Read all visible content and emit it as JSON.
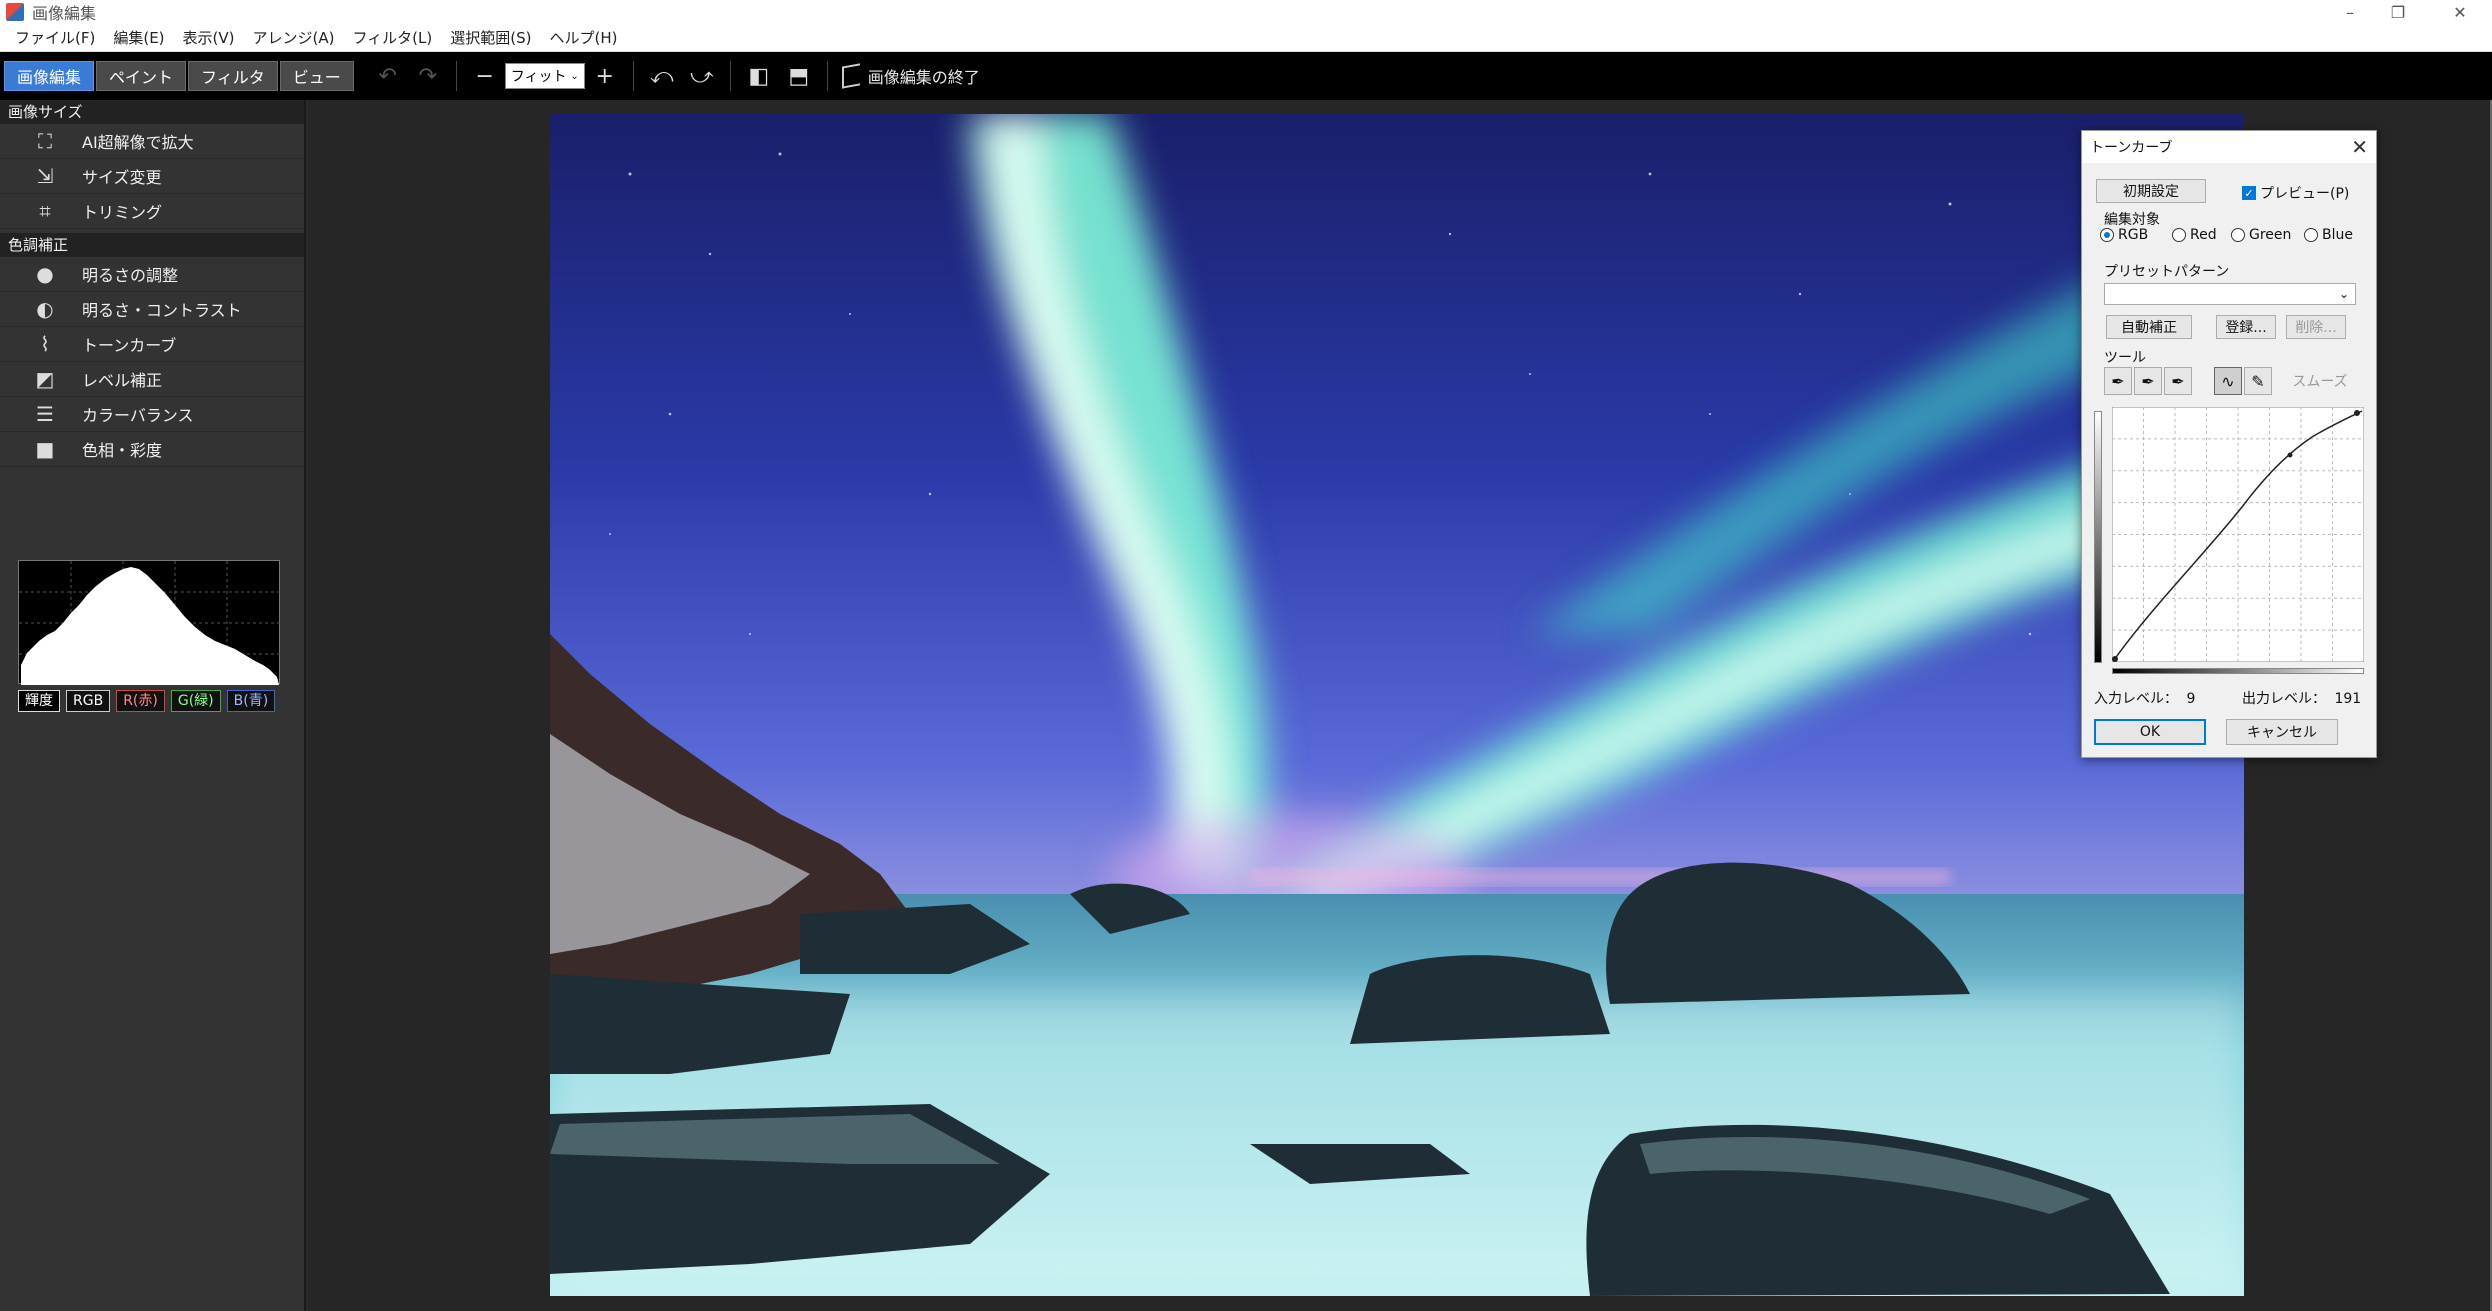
{
  "window": {
    "title": "画像編集",
    "controls": [
      "–",
      "❐",
      "✕"
    ]
  },
  "menu": [
    "ファイル(F)",
    "編集(E)",
    "表示(V)",
    "アレンジ(A)",
    "フィルタ(L)",
    "選択範囲(S)",
    "ヘルプ(H)"
  ],
  "toolbar": {
    "modes": [
      "画像編集",
      "ペイント",
      "フィルタ",
      "ビュー"
    ],
    "active_mode": "画像編集",
    "zoom_value": "フィット",
    "finish_label": "画像編集の終了"
  },
  "left_panel": {
    "size_section": "画像サイズ",
    "size_items": [
      {
        "label": "AI超解像で拡大",
        "icon": "ai-upscale-icon"
      },
      {
        "label": "サイズ変更",
        "icon": "resize-icon"
      },
      {
        "label": "トリミング",
        "icon": "crop-icon"
      }
    ],
    "color_section": "色調補正",
    "color_items": [
      {
        "label": "明るさの調整",
        "icon": "lightbulb-icon"
      },
      {
        "label": "明るさ・コントラスト",
        "icon": "contrast-icon"
      },
      {
        "label": "トーンカーブ",
        "icon": "tone-curve-icon"
      },
      {
        "label": "レベル補正",
        "icon": "levels-icon"
      },
      {
        "label": "カラーバランス",
        "icon": "color-balance-icon"
      },
      {
        "label": "色相・彩度",
        "icon": "hue-saturation-icon"
      }
    ],
    "histogram_buttons": [
      "輝度",
      "RGB",
      "R(赤)",
      "G(緑)",
      "B(青)"
    ]
  },
  "tone_curve_dialog": {
    "title": "トーンカーブ",
    "reset_label": "初期設定",
    "preview_label": "プレビュー(P)",
    "preview_checked": true,
    "target_label": "編集対象",
    "channels": [
      "RGB",
      "Red",
      "Green",
      "Blue"
    ],
    "selected_channel": "RGB",
    "preset_label": "プリセットパターン",
    "preset_value": "",
    "auto_label": "自動補正",
    "register_label": "登録...",
    "delete_label": "削除...",
    "tools_label": "ツール",
    "smooth_label": "スムーズ",
    "input_level_label": "入力レベル：",
    "input_level_value": "9",
    "output_level_label": "出力レベル：",
    "output_level_value": "191",
    "ok_label": "OK",
    "cancel_label": "キャンセル"
  },
  "colors": {
    "accent": "#3a7bd5",
    "dialog_bg": "#f0f0f0",
    "panel_bg": "#333333"
  }
}
